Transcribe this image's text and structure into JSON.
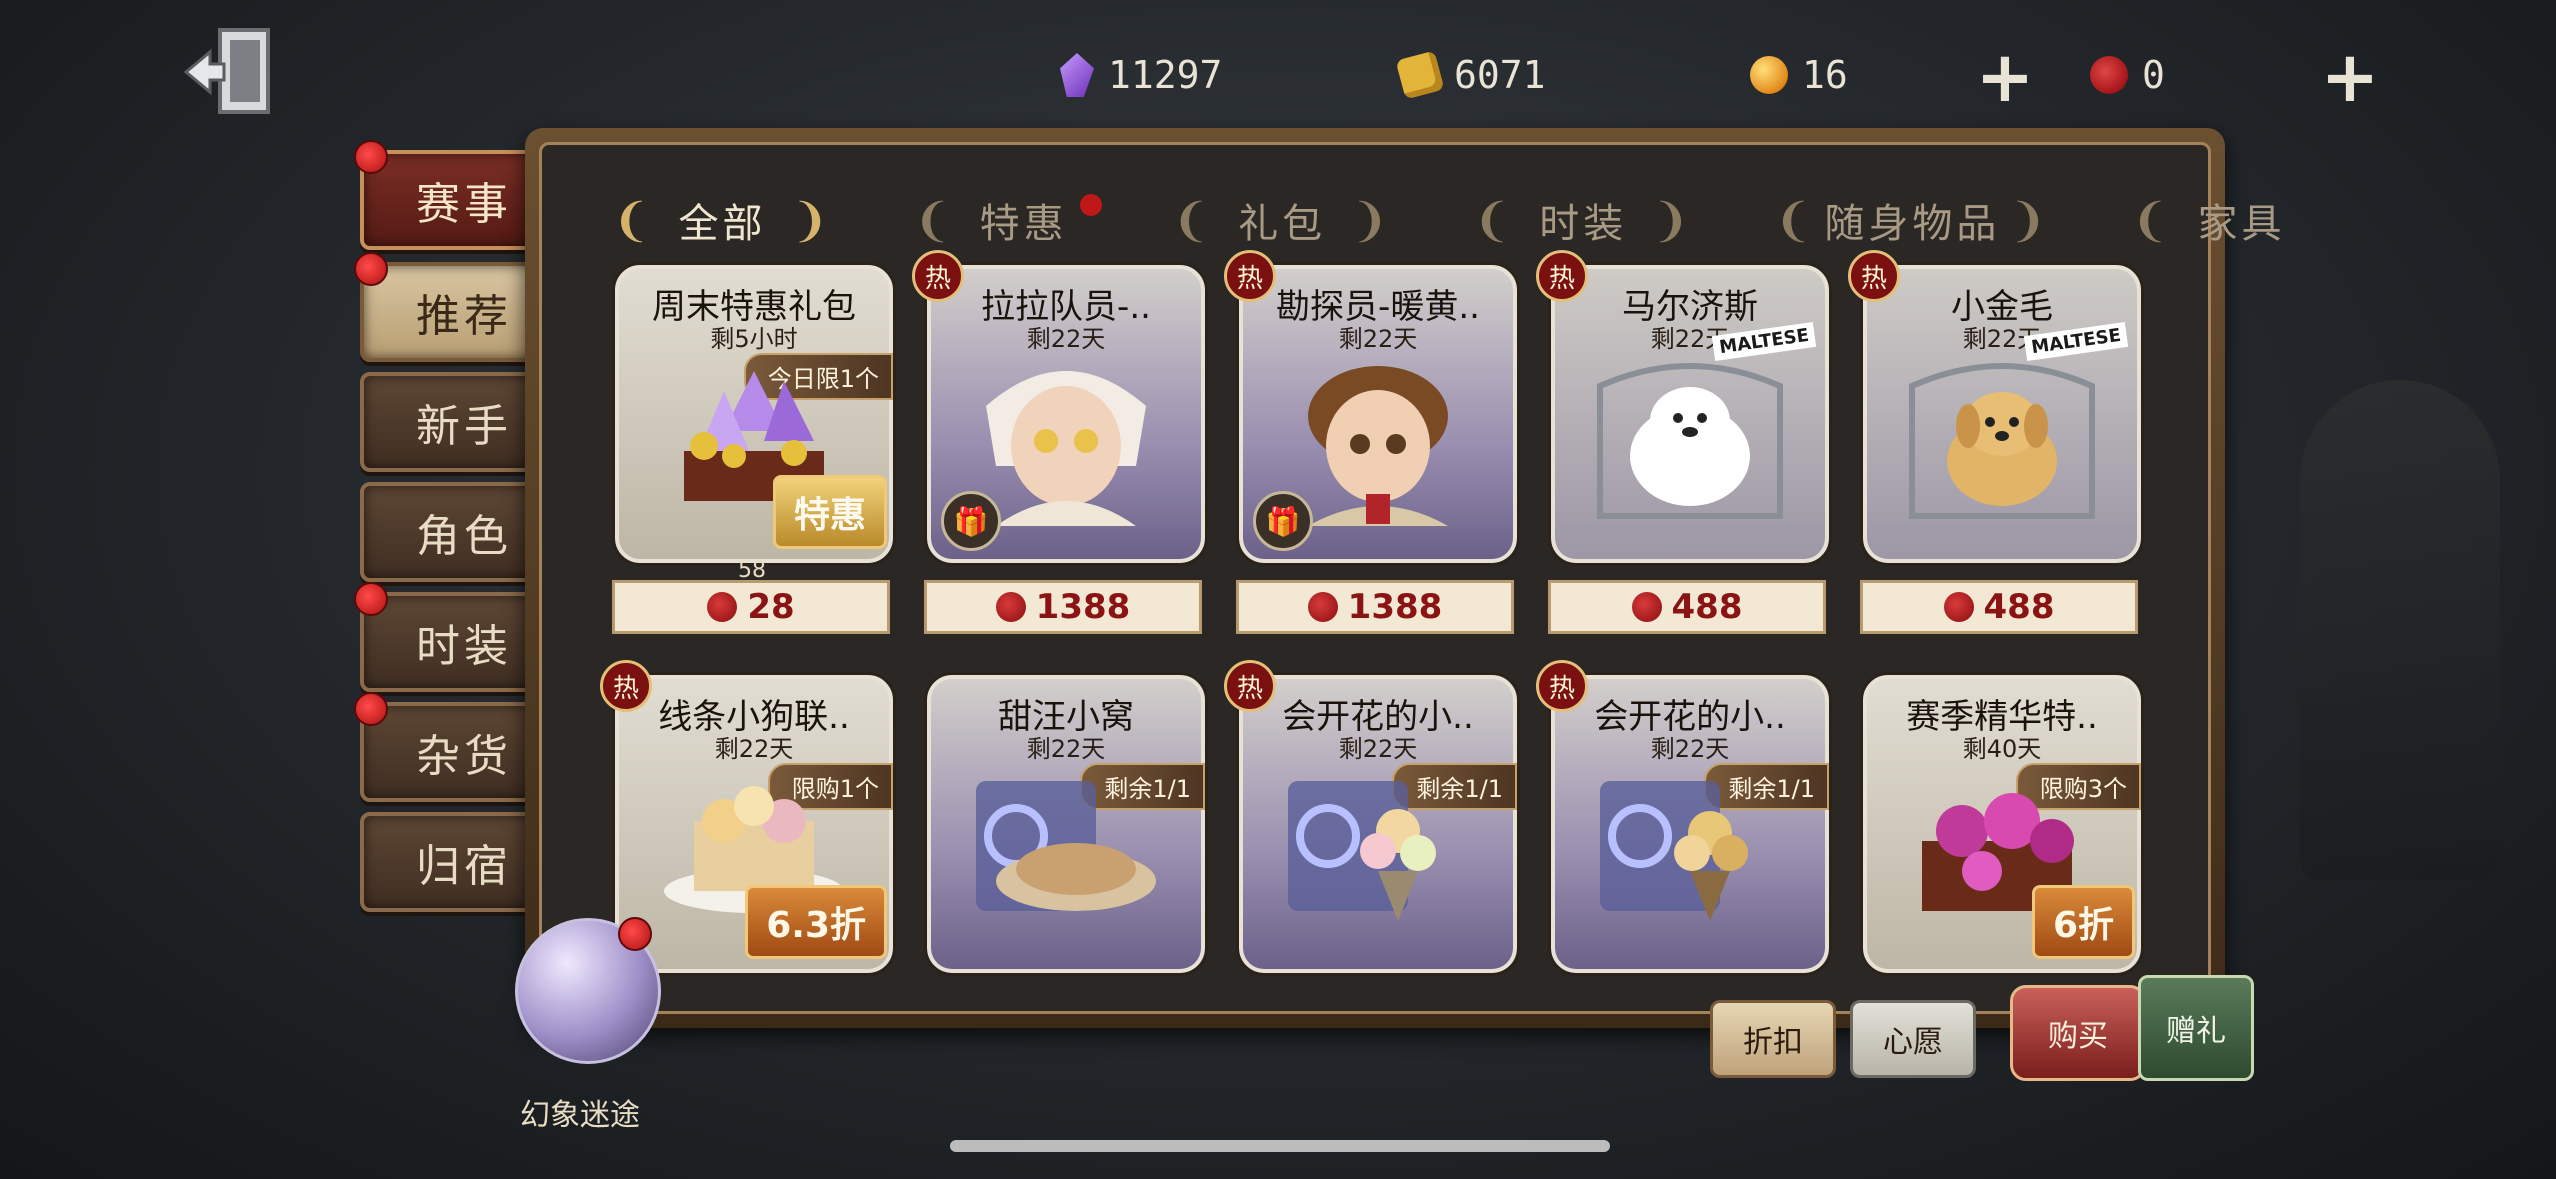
{
  "currencies": {
    "gems": "11297",
    "fragments": "6071",
    "orbs": "16",
    "seals": "0"
  },
  "sidebar": {
    "items": [
      {
        "label": "赛事",
        "badge": true
      },
      {
        "label": "推荐",
        "badge": true
      },
      {
        "label": "新手",
        "badge": false
      },
      {
        "label": "角色",
        "badge": false
      },
      {
        "label": "时装",
        "badge": true
      },
      {
        "label": "杂货",
        "badge": true
      },
      {
        "label": "归宿",
        "badge": false
      }
    ]
  },
  "categories": [
    {
      "label": "全部"
    },
    {
      "label": "特惠"
    },
    {
      "label": "礼包"
    },
    {
      "label": "时装"
    },
    {
      "label": "随身物品"
    },
    {
      "label": "家具"
    }
  ],
  "cards": [
    {
      "title": "周末特惠礼包",
      "sub": "剩5小时",
      "tag": "今日限1个",
      "discount": "特惠",
      "price": "28",
      "price_old": "58",
      "hot": false
    },
    {
      "title": "拉拉队员-..",
      "sub": "剩22天",
      "tag": "",
      "discount": "",
      "price": "1388",
      "hot": true
    },
    {
      "title": "勘探员-暖黄..",
      "sub": "剩22天",
      "tag": "",
      "discount": "",
      "price": "1388",
      "hot": true
    },
    {
      "title": "马尔济斯",
      "sub": "剩22天",
      "tag": "MALTESE",
      "discount": "",
      "price": "488",
      "hot": true
    },
    {
      "title": "小金毛",
      "sub": "剩22天",
      "tag": "MALTESE",
      "discount": "",
      "price": "488",
      "hot": true
    },
    {
      "title": "线条小狗联..",
      "sub": "剩22天",
      "tag": "限购1个",
      "discount": "6.3折",
      "hot": true
    },
    {
      "title": "甜汪小窝",
      "sub": "剩22天",
      "tag": "剩余1/1",
      "discount": "",
      "hot": false
    },
    {
      "title": "会开花的小..",
      "sub": "剩22天",
      "tag": "剩余1/1",
      "discount": "",
      "hot": true
    },
    {
      "title": "会开花的小..",
      "sub": "剩22天",
      "tag": "剩余1/1",
      "discount": "",
      "hot": true
    },
    {
      "title": "赛季精华特..",
      "sub": "剩40天",
      "tag": "限购3个",
      "discount": "6折",
      "hot": false
    }
  ],
  "bottom": {
    "discount_btn": "折扣",
    "wish_btn": "心愿",
    "buy_btn": "购买",
    "gift_btn": "赠礼"
  },
  "event_label": "幻象迷途"
}
